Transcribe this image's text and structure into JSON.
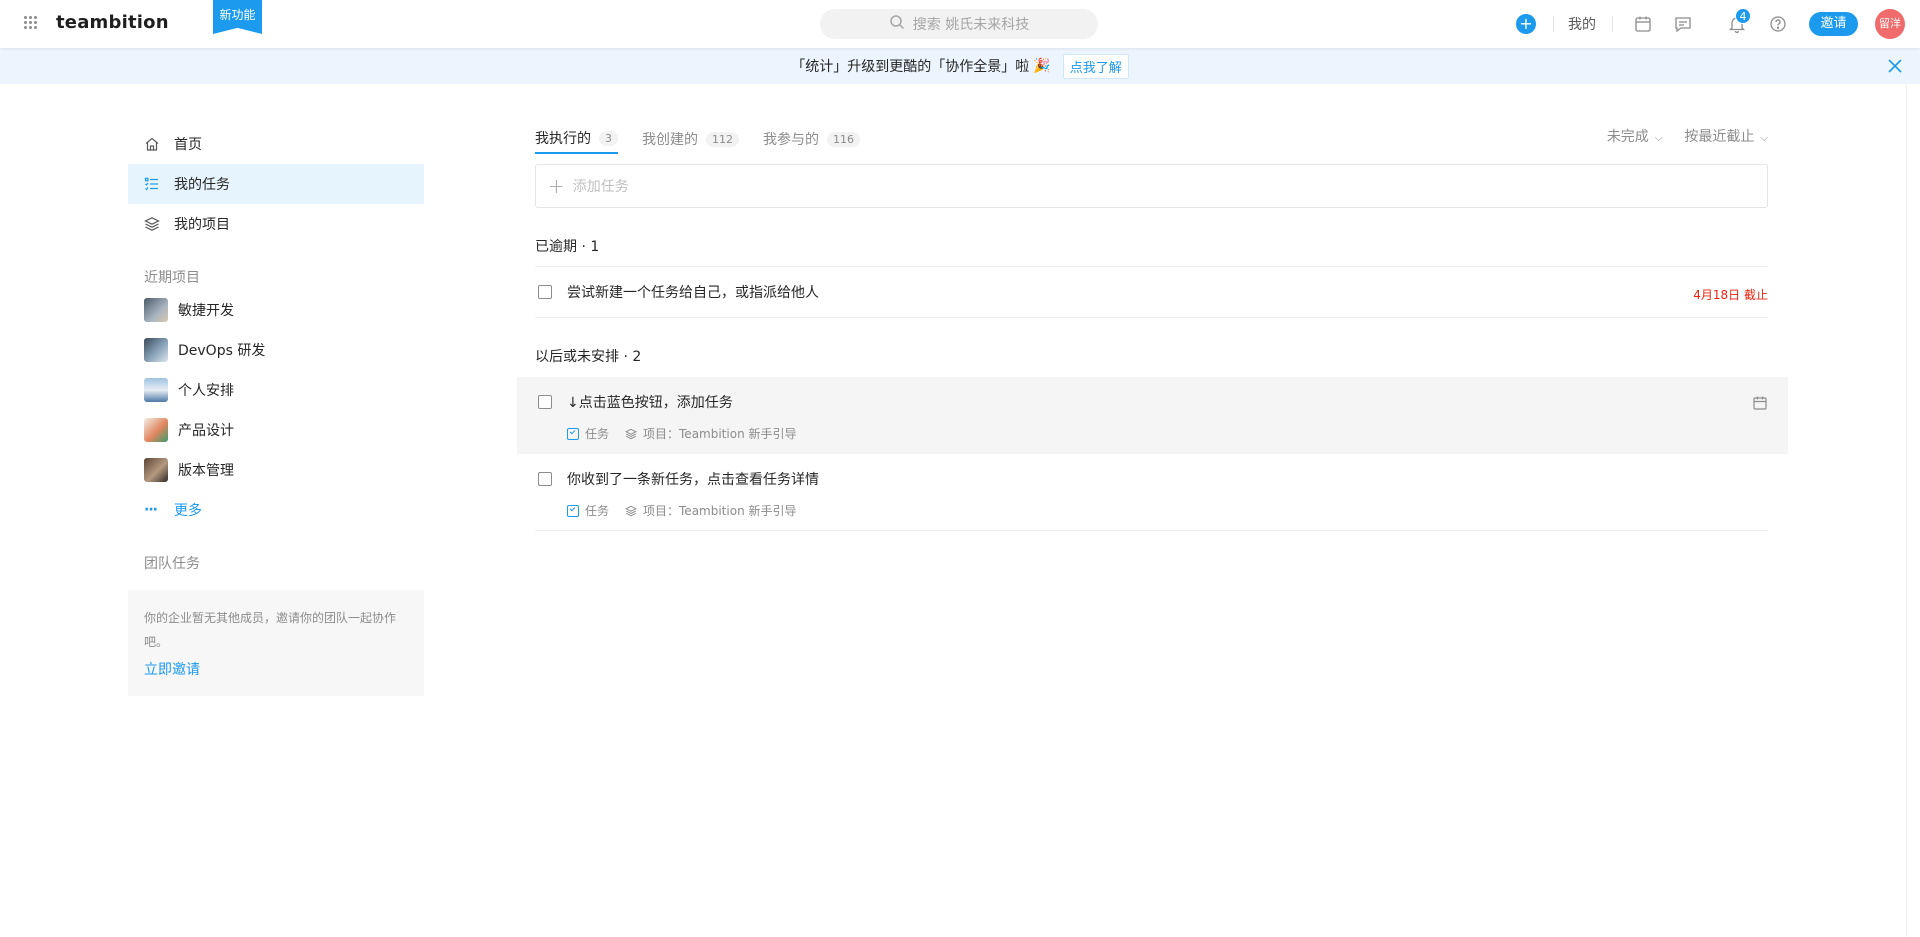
{
  "header": {
    "logo": "teambition",
    "new_feature": "新功能",
    "search_placeholder": "搜索 姚氏未来科技",
    "mine_label": "我的",
    "notification_count": "4",
    "invite_label": "邀请",
    "avatar_text": "留洋",
    "accent": "#1b9aee"
  },
  "banner": {
    "text": "「统计」升级到更酷的「协作全景」啦",
    "emoji": "🎉",
    "link": "点我了解"
  },
  "sidebar": {
    "nav": [
      {
        "label": "首页",
        "icon": "home-icon"
      },
      {
        "label": "我的任务",
        "icon": "task-list-icon"
      },
      {
        "label": "我的项目",
        "icon": "layers-icon"
      }
    ],
    "recent_title": "近期项目",
    "projects": [
      {
        "label": "敏捷开发",
        "color": "#6b7a8f"
      },
      {
        "label": "DevOps 研发",
        "color": "#5d6f80"
      },
      {
        "label": "个人安排",
        "color": "#7aa0c4"
      },
      {
        "label": "产品设计",
        "color": "#d9826b"
      },
      {
        "label": "版本管理",
        "color": "#8a6e5c"
      }
    ],
    "more_label": "更多",
    "team_title": "团队任务",
    "team_text": "你的企业暂无其他成员，邀请你的团队一起协作吧。",
    "team_link": "立即邀请"
  },
  "main": {
    "tabs": [
      {
        "label": "我执行的",
        "count": "3"
      },
      {
        "label": "我创建的",
        "count": "112"
      },
      {
        "label": "我参与的",
        "count": "116"
      }
    ],
    "filter_status": "未完成",
    "filter_sort": "按最近截止",
    "add_task_placeholder": "添加任务",
    "groups": [
      {
        "title": "已逾期 · 1",
        "tasks": [
          {
            "title": "尝试新建一个任务给自己，或指派给他人",
            "due": "4月18日 截止"
          }
        ]
      },
      {
        "title": "以后或未安排 · 2",
        "tasks": [
          {
            "title": "↓点击蓝色按钮，添加任务",
            "type": "任务",
            "project": "项目：Teambition 新手引导"
          },
          {
            "title": "你收到了一条新任务，点击查看任务详情",
            "type": "任务",
            "project": "项目：Teambition 新手引导"
          }
        ]
      }
    ]
  }
}
